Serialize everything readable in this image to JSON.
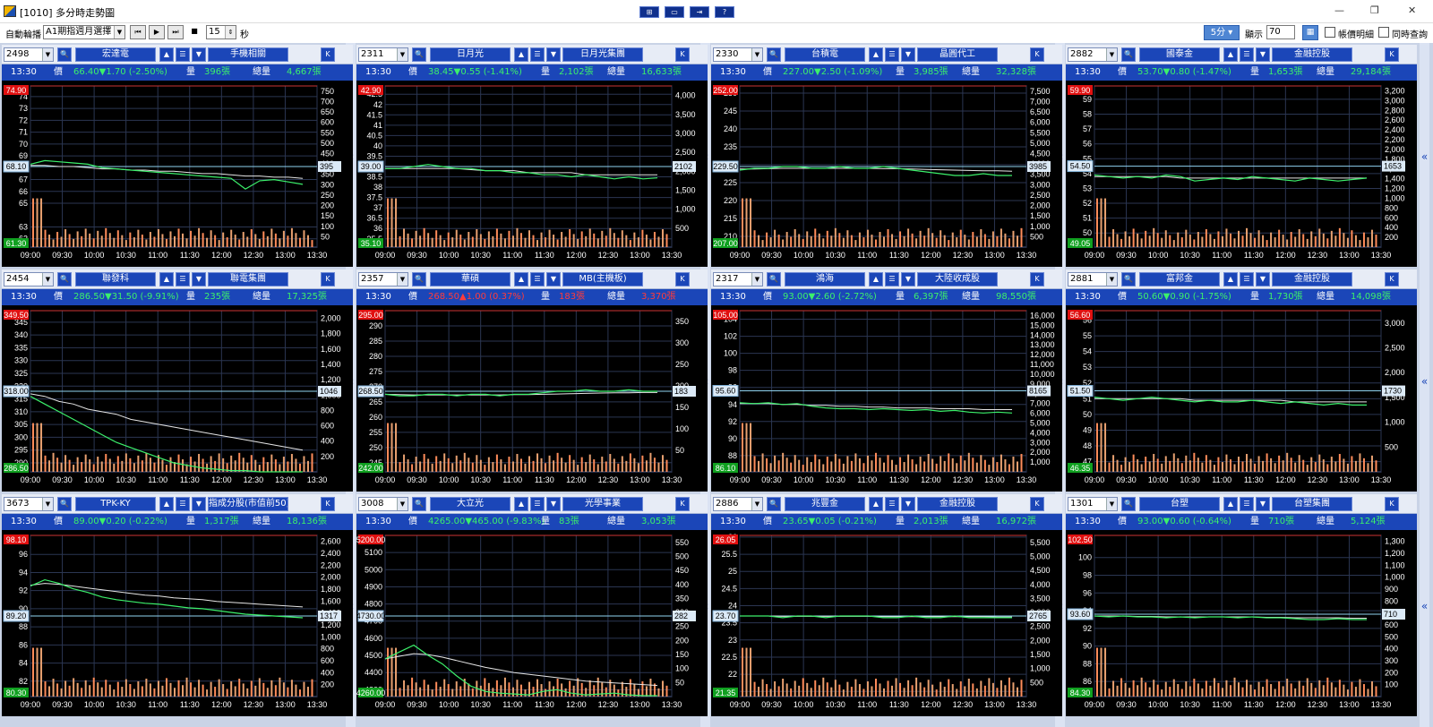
{
  "title": "[1010] 多分時走勢圖",
  "titlebar_buttons": [
    "⊞",
    "▭",
    "⇥",
    "?"
  ],
  "toolbar": {
    "auto_label": "自動輪播",
    "auto_select": "A1期指週月選擇",
    "media": [
      "⏮",
      "▶",
      "⏭",
      "■"
    ],
    "seconds_value": "15",
    "seconds_unit": "秒",
    "period_button": "5分",
    "display_label": "顯示",
    "display_value": "70",
    "checkbox1": "帳價明細",
    "checkbox2": "同時查詢"
  },
  "panel_labels": {
    "price": "價",
    "vol": "量",
    "total": "總量",
    "k": "K",
    "collapse": "«"
  },
  "panels": [
    {
      "code": "2498",
      "name": "宏達電",
      "group": "手機相關",
      "time": "13:30",
      "price": "66.40",
      "chg": "▼1.70 (-2.50%)",
      "dir": "dn",
      "vol": "396張",
      "total": "4,667張",
      "ref": 68.1,
      "ref_label": "68.10",
      "hi": "74.90",
      "lo": "61.30",
      "ymin": 61.3,
      "ymax": 74.9,
      "left_ticks": [
        "74",
        "73",
        "72",
        "71",
        "70",
        "69",
        "67",
        "66",
        "65",
        "63",
        "62"
      ],
      "right_ticks": [
        "750",
        "700",
        "650",
        "600",
        "550",
        "500",
        "450",
        "400",
        "350",
        "300",
        "250",
        "200",
        "150",
        "100",
        "50"
      ],
      "right_tag": "395",
      "series": [
        68.3,
        68.6,
        68.5,
        68.4,
        68.3,
        68.0,
        67.9,
        67.8,
        67.7,
        67.6,
        67.5,
        67.4,
        67.3,
        67.2,
        67.1,
        66.2,
        66.9,
        67.0,
        66.8,
        66.6
      ],
      "avg": [
        68.2,
        68.2,
        68.1,
        68.1,
        68.0,
        67.9,
        67.9,
        67.8,
        67.8,
        67.7,
        67.7,
        67.6,
        67.5,
        67.5,
        67.4,
        67.3,
        67.3,
        67.2,
        67.2,
        67.1
      ]
    },
    {
      "code": "2311",
      "name": "日月光",
      "group": "日月光集團",
      "time": "13:30",
      "price": "38.45",
      "chg": "▼0.55 (-1.41%)",
      "dir": "dn",
      "vol": "2,102張",
      "total": "16,633張",
      "ref": 39.0,
      "ref_label": "39.00",
      "hi": "42.90",
      "lo": "35.10",
      "ymin": 35.1,
      "ymax": 42.9,
      "left_ticks": [
        "42.5",
        "42",
        "41.5",
        "41",
        "40.5",
        "40",
        "39.5",
        "38.5",
        "38",
        "37.5",
        "37",
        "36.5",
        "36",
        "35.5"
      ],
      "right_ticks": [
        "4,000",
        "3,500",
        "3,000",
        "2,500",
        "2,000",
        "1,500",
        "1,000",
        "500"
      ],
      "right_tag": "2102",
      "series": [
        38.9,
        38.9,
        39.0,
        39.1,
        39.0,
        38.9,
        38.9,
        38.8,
        38.8,
        38.7,
        38.7,
        38.6,
        38.6,
        38.5,
        38.6,
        38.5,
        38.4,
        38.5,
        38.4,
        38.45
      ],
      "avg": [
        38.9,
        38.9,
        38.9,
        38.9,
        38.9,
        38.9,
        38.85,
        38.8,
        38.8,
        38.8,
        38.7,
        38.7,
        38.7,
        38.7,
        38.6,
        38.6,
        38.6,
        38.6,
        38.6,
        38.6
      ]
    },
    {
      "code": "2330",
      "name": "台積電",
      "group": "晶圓代工",
      "time": "13:30",
      "price": "227.00",
      "chg": "▼2.50 (-1.09%)",
      "dir": "dn",
      "vol": "3,985張",
      "total": "32,328張",
      "ref": 229.5,
      "ref_label": "229.50",
      "hi": "252.00",
      "lo": "207.00",
      "ymin": 207,
      "ymax": 252,
      "left_ticks": [
        "250",
        "245",
        "240",
        "235",
        "230",
        "225",
        "220",
        "215",
        "210"
      ],
      "right_ticks": [
        "7,500",
        "7,000",
        "6,500",
        "6,000",
        "5,500",
        "5,000",
        "4,500",
        "4,000",
        "3,500",
        "3,000",
        "2,500",
        "2,000",
        "1,500",
        "1,000",
        "500"
      ],
      "right_tag": "3985",
      "series": [
        228.5,
        229.0,
        229.0,
        229.5,
        229.5,
        229.0,
        229.0,
        229.5,
        229.0,
        229.0,
        229.5,
        229.0,
        228.5,
        228.0,
        227.5,
        227.0,
        227.0,
        227.5,
        227.0,
        227.0
      ],
      "avg": [
        228.8,
        228.8,
        228.9,
        229.0,
        229.0,
        229.0,
        229.0,
        229.0,
        229.0,
        229.0,
        228.9,
        228.9,
        228.8,
        228.7,
        228.6,
        228.5,
        228.4,
        228.3,
        228.3,
        228.2
      ]
    },
    {
      "code": "2882",
      "name": "國泰金",
      "group": "金融控股",
      "time": "13:30",
      "price": "53.70",
      "chg": "▼0.80 (-1.47%)",
      "dir": "dn",
      "vol": "1,653張",
      "total": "29,184張",
      "ref": 54.5,
      "ref_label": "54.50",
      "hi": "59.90",
      "lo": "49.05",
      "ymin": 49.05,
      "ymax": 59.9,
      "left_ticks": [
        "59",
        "58",
        "57",
        "56",
        "55",
        "54",
        "53",
        "52",
        "51",
        "50"
      ],
      "right_ticks": [
        "3,200",
        "3,000",
        "2,800",
        "2,600",
        "2,400",
        "2,200",
        "2,000",
        "1,800",
        "1,600",
        "1,400",
        "1,200",
        "1,000",
        "800",
        "600",
        "400",
        "200"
      ],
      "right_tag": "1653",
      "series": [
        53.9,
        53.8,
        53.7,
        53.8,
        53.7,
        53.9,
        53.8,
        53.5,
        53.6,
        53.7,
        53.6,
        53.8,
        53.7,
        53.6,
        53.5,
        53.7,
        53.6,
        53.5,
        53.6,
        53.7
      ],
      "avg": [
        53.8,
        53.8,
        53.8,
        53.8,
        53.8,
        53.8,
        53.7,
        53.7,
        53.7,
        53.7,
        53.7,
        53.7,
        53.7,
        53.7,
        53.7,
        53.7,
        53.7,
        53.7,
        53.7,
        53.7
      ]
    },
    {
      "code": "2454",
      "name": "聯發科",
      "group": "聯電集團",
      "time": "13:30",
      "price": "286.50",
      "chg": "▼31.50 (-9.91%)",
      "dir": "dn",
      "vol": "235張",
      "total": "17,325張",
      "ref": 318.0,
      "ref_label": "318.00",
      "hi": "349.50",
      "lo": "286.50",
      "ymin": 286.5,
      "ymax": 349.5,
      "left_ticks": [
        "345",
        "340",
        "335",
        "330",
        "325",
        "320",
        "315",
        "310",
        "305",
        "300",
        "295",
        "290"
      ],
      "right_ticks": [
        "2,000",
        "1,800",
        "1,600",
        "1,400",
        "1,200",
        "1,000",
        "800",
        "600",
        "400",
        "200"
      ],
      "right_tag": "1046",
      "series": [
        316,
        313,
        310,
        307,
        304,
        301,
        298,
        296,
        294,
        292,
        290,
        289,
        288,
        287.5,
        287,
        287,
        286.5,
        286.5,
        286.5,
        286.5
      ],
      "avg": [
        317,
        316,
        314,
        313,
        311,
        310,
        309,
        307,
        306,
        305,
        304,
        303,
        302,
        301,
        300,
        299,
        298,
        297,
        296,
        295
      ]
    },
    {
      "code": "2357",
      "name": "華碩",
      "group": "MB(主機板)",
      "time": "13:30",
      "price": "268.50",
      "chg": "▲1.00 (0.37%)",
      "dir": "up",
      "vol": "183張",
      "total": "3,370張",
      "ref": 268.5,
      "ref_label": "268.50",
      "hi": "295.00",
      "lo": "242.00",
      "ymin": 242,
      "ymax": 295,
      "left_ticks": [
        "290",
        "285",
        "280",
        "275",
        "270",
        "265",
        "260",
        "255",
        "250",
        "245"
      ],
      "right_ticks": [
        "350",
        "300",
        "250",
        "200",
        "150",
        "100",
        "50"
      ],
      "right_tag": "183",
      "series": [
        267.5,
        267.0,
        267.0,
        267.5,
        267.5,
        267.0,
        267.5,
        267.5,
        267.0,
        267.5,
        267.5,
        268.0,
        268.5,
        268.5,
        269.0,
        268.5,
        268.5,
        269.0,
        268.5,
        268.5
      ],
      "avg": [
        267.5,
        267.4,
        267.3,
        267.3,
        267.3,
        267.3,
        267.3,
        267.3,
        267.3,
        267.4,
        267.4,
        267.5,
        267.6,
        267.7,
        267.8,
        267.9,
        268.0,
        268.0,
        268.1,
        268.1
      ]
    },
    {
      "code": "2317",
      "name": "鴻海",
      "group": "大陸收成股",
      "time": "13:30",
      "price": "93.00",
      "chg": "▼2.60 (-2.72%)",
      "dir": "dn",
      "vol": "6,397張",
      "total": "98,550張",
      "ref": 95.6,
      "ref_label": "95.60",
      "hi": "105.00",
      "lo": "86.10",
      "ymin": 86.1,
      "ymax": 105,
      "left_ticks": [
        "104",
        "102",
        "100",
        "98",
        "96",
        "94",
        "92",
        "90",
        "88"
      ],
      "right_ticks": [
        "16,000",
        "15,000",
        "14,000",
        "13,000",
        "12,000",
        "11,000",
        "10,000",
        "9,000",
        "8,000",
        "7,000",
        "6,000",
        "5,000",
        "4,000",
        "3,000",
        "2,000",
        "1,000"
      ],
      "right_tag": "8165",
      "series": [
        94.2,
        94.1,
        94.2,
        94.0,
        94.1,
        93.8,
        93.6,
        93.5,
        93.5,
        93.4,
        93.5,
        93.4,
        93.3,
        93.4,
        93.2,
        93.3,
        93.1,
        93.0,
        93.1,
        93.0
      ],
      "avg": [
        94.1,
        94.1,
        94.1,
        94.0,
        94.0,
        93.9,
        93.9,
        93.8,
        93.8,
        93.7,
        93.7,
        93.6,
        93.6,
        93.6,
        93.5,
        93.5,
        93.5,
        93.4,
        93.4,
        93.4
      ]
    },
    {
      "code": "2881",
      "name": "富邦金",
      "group": "金融控股",
      "time": "13:30",
      "price": "50.60",
      "chg": "▼0.90 (-1.75%)",
      "dir": "dn",
      "vol": "1,730張",
      "total": "14,098張",
      "ref": 51.5,
      "ref_label": "51.50",
      "hi": "56.60",
      "lo": "46.35",
      "ymin": 46.35,
      "ymax": 56.6,
      "left_ticks": [
        "56",
        "55",
        "54",
        "53",
        "52",
        "51",
        "50",
        "49",
        "48",
        "47"
      ],
      "right_ticks": [
        "3,000",
        "2,500",
        "2,000",
        "1,500",
        "1,000",
        "500"
      ],
      "right_tag": "1730",
      "series": [
        51.1,
        51.0,
        50.9,
        51.0,
        51.1,
        51.0,
        50.9,
        50.8,
        50.9,
        50.8,
        50.8,
        50.9,
        50.8,
        50.7,
        50.8,
        50.7,
        50.6,
        50.7,
        50.6,
        50.6
      ],
      "avg": [
        51.0,
        51.0,
        51.0,
        51.0,
        51.0,
        51.0,
        51.0,
        50.9,
        50.9,
        50.9,
        50.9,
        50.9,
        50.9,
        50.9,
        50.8,
        50.8,
        50.8,
        50.8,
        50.8,
        50.8
      ]
    },
    {
      "code": "3673",
      "name": "TPK-KY",
      "group": "指成分股(市值前50)",
      "time": "13:30",
      "price": "89.00",
      "chg": "▼0.20 (-0.22%)",
      "dir": "dn",
      "vol": "1,317張",
      "total": "18,136張",
      "ref": 89.2,
      "ref_label": "89.20",
      "hi": "98.10",
      "lo": "80.30",
      "ymin": 80.3,
      "ymax": 98.1,
      "left_ticks": [
        "96",
        "94",
        "92",
        "90",
        "88",
        "86",
        "84",
        "82"
      ],
      "right_ticks": [
        "2,600",
        "2,400",
        "2,200",
        "2,000",
        "1,800",
        "1,600",
        "1,400",
        "1,200",
        "1,000",
        "800",
        "600",
        "400",
        "200"
      ],
      "right_tag": "1317",
      "series": [
        92.5,
        93.2,
        92.8,
        92.2,
        91.8,
        91.3,
        91.0,
        90.8,
        90.6,
        90.5,
        90.3,
        90.1,
        90.0,
        89.8,
        89.6,
        89.4,
        89.3,
        89.2,
        89.1,
        89.0
      ],
      "avg": [
        92.6,
        92.8,
        92.7,
        92.5,
        92.3,
        92.1,
        91.9,
        91.7,
        91.5,
        91.4,
        91.2,
        91.1,
        91.0,
        90.8,
        90.7,
        90.6,
        90.5,
        90.4,
        90.3,
        90.2
      ]
    },
    {
      "code": "3008",
      "name": "大立光",
      "group": "光學事業",
      "time": "13:30",
      "price": "4265.00",
      "chg": "▼465.00 (-9.83%)",
      "dir": "dn",
      "vol": "83張",
      "total": "3,053張",
      "ref": 4730,
      "ref_label": "4730.00",
      "hi": "5200.00",
      "lo": "4260.00",
      "ymin": 4260,
      "ymax": 5200,
      "left_ticks": [
        "5100",
        "5000",
        "4900",
        "4800",
        "4700",
        "4600",
        "4500",
        "4400",
        "4300"
      ],
      "right_ticks": [
        "550",
        "500",
        "450",
        "400",
        "350",
        "300",
        "250",
        "200",
        "150",
        "100",
        "50"
      ],
      "right_tag": "282",
      "series": [
        4480,
        4520,
        4560,
        4500,
        4450,
        4380,
        4320,
        4290,
        4280,
        4275,
        4270,
        4290,
        4300,
        4280,
        4270,
        4275,
        4280,
        4270,
        4265,
        4265
      ],
      "avg": [
        4480,
        4495,
        4510,
        4505,
        4490,
        4470,
        4450,
        4430,
        4415,
        4400,
        4390,
        4380,
        4370,
        4360,
        4350,
        4345,
        4340,
        4335,
        4330,
        4325
      ]
    },
    {
      "code": "2886",
      "name": "兆豐金",
      "group": "金融控股",
      "time": "13:30",
      "price": "23.65",
      "chg": "▼0.05 (-0.21%)",
      "dir": "dn",
      "vol": "2,013張",
      "total": "16,972張",
      "ref": 23.7,
      "ref_label": "23.70",
      "hi": "26.05",
      "lo": "21.35",
      "ymin": 21.35,
      "ymax": 26.05,
      "left_ticks": [
        "26",
        "25.5",
        "25",
        "24.5",
        "24",
        "23.5",
        "23",
        "22.5",
        "22",
        "21.5"
      ],
      "right_ticks": [
        "5,500",
        "5,000",
        "4,500",
        "4,000",
        "3,500",
        "3,000",
        "2,500",
        "2,000",
        "1,500",
        "1,000",
        "500"
      ],
      "right_tag": "2765",
      "series": [
        23.7,
        23.7,
        23.7,
        23.65,
        23.7,
        23.7,
        23.65,
        23.7,
        23.7,
        23.7,
        23.65,
        23.65,
        23.7,
        23.65,
        23.65,
        23.7,
        23.65,
        23.65,
        23.65,
        23.65
      ],
      "avg": [
        23.7,
        23.7,
        23.7,
        23.69,
        23.69,
        23.69,
        23.69,
        23.69,
        23.69,
        23.69,
        23.68,
        23.68,
        23.68,
        23.68,
        23.68,
        23.68,
        23.68,
        23.68,
        23.67,
        23.67
      ]
    },
    {
      "code": "1301",
      "name": "台塑",
      "group": "台塑集團",
      "time": "13:30",
      "price": "93.00",
      "chg": "▼0.60 (-0.64%)",
      "dir": "dn",
      "vol": "710張",
      "total": "5,124張",
      "ref": 93.6,
      "ref_label": "93.60",
      "hi": "102.50",
      "lo": "84.30",
      "ymin": 84.3,
      "ymax": 102.5,
      "left_ticks": [
        "100",
        "98",
        "96",
        "94",
        "92",
        "90",
        "88",
        "86"
      ],
      "right_ticks": [
        "1,300",
        "1,200",
        "1,100",
        "1,000",
        "900",
        "800",
        "700",
        "600",
        "500",
        "400",
        "300",
        "200",
        "100"
      ],
      "right_tag": "710",
      "series": [
        93.4,
        93.3,
        93.4,
        93.3,
        93.3,
        93.2,
        93.3,
        93.2,
        93.3,
        93.3,
        93.2,
        93.3,
        93.2,
        93.2,
        93.1,
        93.0,
        93.0,
        93.1,
        93.0,
        93.0
      ],
      "avg": [
        93.4,
        93.4,
        93.4,
        93.35,
        93.35,
        93.3,
        93.3,
        93.3,
        93.3,
        93.3,
        93.3,
        93.3,
        93.25,
        93.25,
        93.2,
        93.2,
        93.2,
        93.2,
        93.15,
        93.15
      ]
    }
  ],
  "x_labels": [
    "09:00",
    "09:30",
    "10:00",
    "10:30",
    "11:00",
    "11:30",
    "12:00",
    "12:30",
    "13:00",
    "13:30"
  ]
}
